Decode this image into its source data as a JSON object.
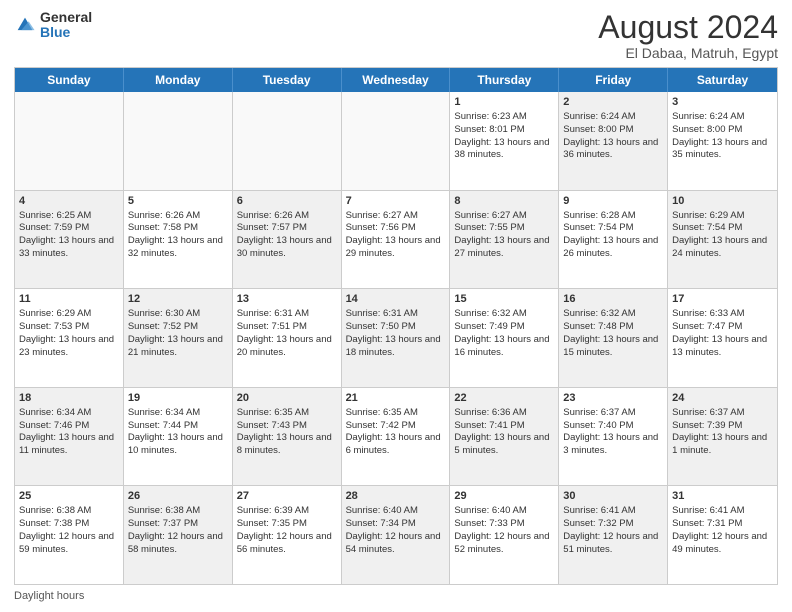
{
  "logo": {
    "general": "General",
    "blue": "Blue"
  },
  "title": "August 2024",
  "subtitle": "El Dabaa, Matruh, Egypt",
  "days": [
    "Sunday",
    "Monday",
    "Tuesday",
    "Wednesday",
    "Thursday",
    "Friday",
    "Saturday"
  ],
  "footer_label": "Daylight hours",
  "weeks": [
    [
      {
        "day": "",
        "sunrise": "",
        "sunset": "",
        "daylight": "",
        "empty": true
      },
      {
        "day": "",
        "sunrise": "",
        "sunset": "",
        "daylight": "",
        "empty": true
      },
      {
        "day": "",
        "sunrise": "",
        "sunset": "",
        "daylight": "",
        "empty": true
      },
      {
        "day": "",
        "sunrise": "",
        "sunset": "",
        "daylight": "",
        "empty": true
      },
      {
        "day": "1",
        "sunrise": "Sunrise: 6:23 AM",
        "sunset": "Sunset: 8:01 PM",
        "daylight": "Daylight: 13 hours and 38 minutes.",
        "empty": false,
        "shaded": false
      },
      {
        "day": "2",
        "sunrise": "Sunrise: 6:24 AM",
        "sunset": "Sunset: 8:00 PM",
        "daylight": "Daylight: 13 hours and 36 minutes.",
        "empty": false,
        "shaded": true
      },
      {
        "day": "3",
        "sunrise": "Sunrise: 6:24 AM",
        "sunset": "Sunset: 8:00 PM",
        "daylight": "Daylight: 13 hours and 35 minutes.",
        "empty": false,
        "shaded": false
      }
    ],
    [
      {
        "day": "4",
        "sunrise": "Sunrise: 6:25 AM",
        "sunset": "Sunset: 7:59 PM",
        "daylight": "Daylight: 13 hours and 33 minutes.",
        "empty": false,
        "shaded": true
      },
      {
        "day": "5",
        "sunrise": "Sunrise: 6:26 AM",
        "sunset": "Sunset: 7:58 PM",
        "daylight": "Daylight: 13 hours and 32 minutes.",
        "empty": false,
        "shaded": false
      },
      {
        "day": "6",
        "sunrise": "Sunrise: 6:26 AM",
        "sunset": "Sunset: 7:57 PM",
        "daylight": "Daylight: 13 hours and 30 minutes.",
        "empty": false,
        "shaded": true
      },
      {
        "day": "7",
        "sunrise": "Sunrise: 6:27 AM",
        "sunset": "Sunset: 7:56 PM",
        "daylight": "Daylight: 13 hours and 29 minutes.",
        "empty": false,
        "shaded": false
      },
      {
        "day": "8",
        "sunrise": "Sunrise: 6:27 AM",
        "sunset": "Sunset: 7:55 PM",
        "daylight": "Daylight: 13 hours and 27 minutes.",
        "empty": false,
        "shaded": true
      },
      {
        "day": "9",
        "sunrise": "Sunrise: 6:28 AM",
        "sunset": "Sunset: 7:54 PM",
        "daylight": "Daylight: 13 hours and 26 minutes.",
        "empty": false,
        "shaded": false
      },
      {
        "day": "10",
        "sunrise": "Sunrise: 6:29 AM",
        "sunset": "Sunset: 7:54 PM",
        "daylight": "Daylight: 13 hours and 24 minutes.",
        "empty": false,
        "shaded": true
      }
    ],
    [
      {
        "day": "11",
        "sunrise": "Sunrise: 6:29 AM",
        "sunset": "Sunset: 7:53 PM",
        "daylight": "Daylight: 13 hours and 23 minutes.",
        "empty": false,
        "shaded": false
      },
      {
        "day": "12",
        "sunrise": "Sunrise: 6:30 AM",
        "sunset": "Sunset: 7:52 PM",
        "daylight": "Daylight: 13 hours and 21 minutes.",
        "empty": false,
        "shaded": true
      },
      {
        "day": "13",
        "sunrise": "Sunrise: 6:31 AM",
        "sunset": "Sunset: 7:51 PM",
        "daylight": "Daylight: 13 hours and 20 minutes.",
        "empty": false,
        "shaded": false
      },
      {
        "day": "14",
        "sunrise": "Sunrise: 6:31 AM",
        "sunset": "Sunset: 7:50 PM",
        "daylight": "Daylight: 13 hours and 18 minutes.",
        "empty": false,
        "shaded": true
      },
      {
        "day": "15",
        "sunrise": "Sunrise: 6:32 AM",
        "sunset": "Sunset: 7:49 PM",
        "daylight": "Daylight: 13 hours and 16 minutes.",
        "empty": false,
        "shaded": false
      },
      {
        "day": "16",
        "sunrise": "Sunrise: 6:32 AM",
        "sunset": "Sunset: 7:48 PM",
        "daylight": "Daylight: 13 hours and 15 minutes.",
        "empty": false,
        "shaded": true
      },
      {
        "day": "17",
        "sunrise": "Sunrise: 6:33 AM",
        "sunset": "Sunset: 7:47 PM",
        "daylight": "Daylight: 13 hours and 13 minutes.",
        "empty": false,
        "shaded": false
      }
    ],
    [
      {
        "day": "18",
        "sunrise": "Sunrise: 6:34 AM",
        "sunset": "Sunset: 7:46 PM",
        "daylight": "Daylight: 13 hours and 11 minutes.",
        "empty": false,
        "shaded": true
      },
      {
        "day": "19",
        "sunrise": "Sunrise: 6:34 AM",
        "sunset": "Sunset: 7:44 PM",
        "daylight": "Daylight: 13 hours and 10 minutes.",
        "empty": false,
        "shaded": false
      },
      {
        "day": "20",
        "sunrise": "Sunrise: 6:35 AM",
        "sunset": "Sunset: 7:43 PM",
        "daylight": "Daylight: 13 hours and 8 minutes.",
        "empty": false,
        "shaded": true
      },
      {
        "day": "21",
        "sunrise": "Sunrise: 6:35 AM",
        "sunset": "Sunset: 7:42 PM",
        "daylight": "Daylight: 13 hours and 6 minutes.",
        "empty": false,
        "shaded": false
      },
      {
        "day": "22",
        "sunrise": "Sunrise: 6:36 AM",
        "sunset": "Sunset: 7:41 PM",
        "daylight": "Daylight: 13 hours and 5 minutes.",
        "empty": false,
        "shaded": true
      },
      {
        "day": "23",
        "sunrise": "Sunrise: 6:37 AM",
        "sunset": "Sunset: 7:40 PM",
        "daylight": "Daylight: 13 hours and 3 minutes.",
        "empty": false,
        "shaded": false
      },
      {
        "day": "24",
        "sunrise": "Sunrise: 6:37 AM",
        "sunset": "Sunset: 7:39 PM",
        "daylight": "Daylight: 13 hours and 1 minute.",
        "empty": false,
        "shaded": true
      }
    ],
    [
      {
        "day": "25",
        "sunrise": "Sunrise: 6:38 AM",
        "sunset": "Sunset: 7:38 PM",
        "daylight": "Daylight: 12 hours and 59 minutes.",
        "empty": false,
        "shaded": false
      },
      {
        "day": "26",
        "sunrise": "Sunrise: 6:38 AM",
        "sunset": "Sunset: 7:37 PM",
        "daylight": "Daylight: 12 hours and 58 minutes.",
        "empty": false,
        "shaded": true
      },
      {
        "day": "27",
        "sunrise": "Sunrise: 6:39 AM",
        "sunset": "Sunset: 7:35 PM",
        "daylight": "Daylight: 12 hours and 56 minutes.",
        "empty": false,
        "shaded": false
      },
      {
        "day": "28",
        "sunrise": "Sunrise: 6:40 AM",
        "sunset": "Sunset: 7:34 PM",
        "daylight": "Daylight: 12 hours and 54 minutes.",
        "empty": false,
        "shaded": true
      },
      {
        "day": "29",
        "sunrise": "Sunrise: 6:40 AM",
        "sunset": "Sunset: 7:33 PM",
        "daylight": "Daylight: 12 hours and 52 minutes.",
        "empty": false,
        "shaded": false
      },
      {
        "day": "30",
        "sunrise": "Sunrise: 6:41 AM",
        "sunset": "Sunset: 7:32 PM",
        "daylight": "Daylight: 12 hours and 51 minutes.",
        "empty": false,
        "shaded": true
      },
      {
        "day": "31",
        "sunrise": "Sunrise: 6:41 AM",
        "sunset": "Sunset: 7:31 PM",
        "daylight": "Daylight: 12 hours and 49 minutes.",
        "empty": false,
        "shaded": false
      }
    ]
  ]
}
